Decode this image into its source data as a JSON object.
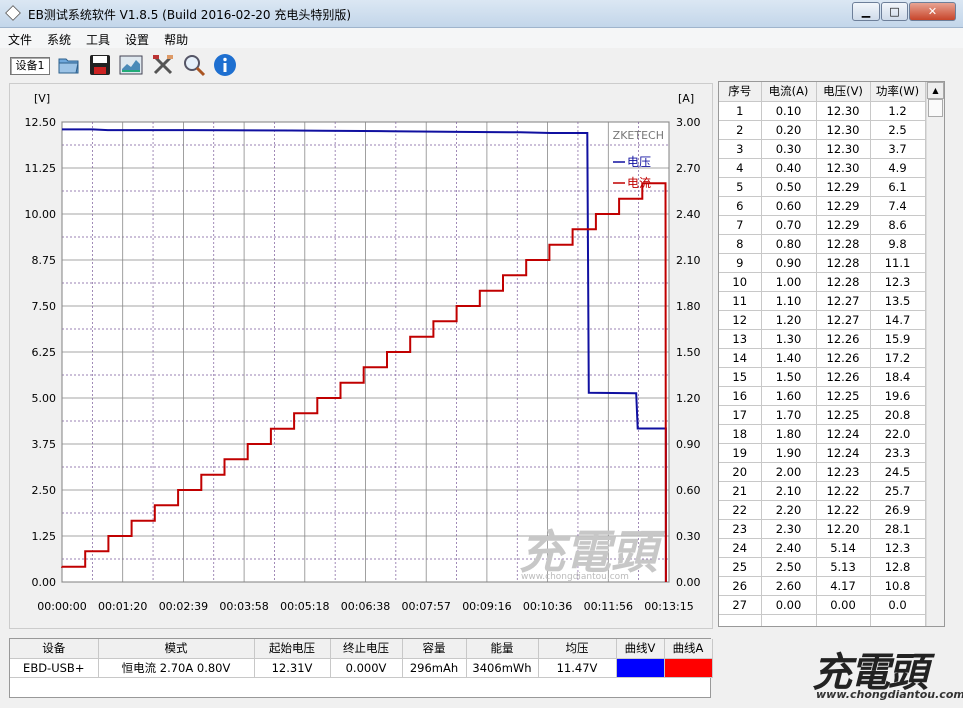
{
  "window": {
    "title": "EB测试系统软件 V1.8.5 (Build 2016-02-20 充电头特别版)",
    "min_label": "▁",
    "max_label": "□",
    "close_label": "✕"
  },
  "menu": {
    "items": [
      "文件",
      "系统",
      "工具",
      "设置",
      "帮助"
    ]
  },
  "toolbar": {
    "device_label": "设备1",
    "icons": [
      "folder-icon",
      "save-icon",
      "chart-icon",
      "tools-icon",
      "magnify-icon",
      "info-icon"
    ]
  },
  "chart_data": {
    "type": "line",
    "left_unit": "[V]",
    "right_unit": "[A]",
    "left_ticks": [
      "12.50",
      "11.25",
      "10.00",
      "8.75",
      "7.50",
      "6.25",
      "5.00",
      "3.75",
      "2.50",
      "1.25",
      "0.00"
    ],
    "right_ticks": [
      "3.00",
      "2.70",
      "2.40",
      "2.10",
      "1.80",
      "1.50",
      "1.20",
      "0.90",
      "0.60",
      "0.30",
      "0.00"
    ],
    "x_ticks": [
      "00:00:00",
      "00:01:20",
      "00:02:39",
      "00:03:58",
      "00:05:18",
      "00:06:38",
      "00:07:57",
      "00:09:16",
      "00:10:36",
      "00:11:56",
      "00:13:15"
    ],
    "x_range_seconds": [
      0,
      795
    ],
    "ylim_left": [
      0,
      12.5
    ],
    "ylim_right": [
      0,
      3.0
    ],
    "brand": "ZKETECH",
    "legend_placement": "top-right",
    "grid": true,
    "series": [
      {
        "name": "电压",
        "axis": "left",
        "color": "#1010a0",
        "points": [
          [
            0,
            12.3
          ],
          [
            40,
            12.3
          ],
          [
            60,
            12.28
          ],
          [
            170,
            12.28
          ],
          [
            300,
            12.27
          ],
          [
            340,
            12.26
          ],
          [
            430,
            12.25
          ],
          [
            520,
            12.23
          ],
          [
            600,
            12.22
          ],
          [
            640,
            12.2
          ],
          [
            688,
            12.2
          ],
          [
            690,
            5.14
          ],
          [
            752,
            5.13
          ],
          [
            754,
            4.17
          ],
          [
            791,
            4.17
          ],
          [
            791,
            0.0
          ]
        ]
      },
      {
        "name": "电流",
        "axis": "right",
        "color": "#c00000",
        "current_step_values": [
          0.1,
          0.2,
          0.3,
          0.4,
          0.5,
          0.6,
          0.7,
          0.8,
          0.9,
          1.0,
          1.1,
          1.2,
          1.3,
          1.4,
          1.5,
          1.6,
          1.7,
          1.8,
          1.9,
          2.0,
          2.1,
          2.2,
          2.3,
          2.4,
          2.5,
          2.6
        ],
        "step_seconds": 30.4,
        "end_seconds": 791
      }
    ]
  },
  "data_table": {
    "headers": [
      "序号",
      "电流(A)",
      "电压(V)",
      "功率(W)"
    ],
    "rows": [
      [
        "1",
        "0.10",
        "12.30",
        "1.2"
      ],
      [
        "2",
        "0.20",
        "12.30",
        "2.5"
      ],
      [
        "3",
        "0.30",
        "12.30",
        "3.7"
      ],
      [
        "4",
        "0.40",
        "12.30",
        "4.9"
      ],
      [
        "5",
        "0.50",
        "12.29",
        "6.1"
      ],
      [
        "6",
        "0.60",
        "12.29",
        "7.4"
      ],
      [
        "7",
        "0.70",
        "12.29",
        "8.6"
      ],
      [
        "8",
        "0.80",
        "12.28",
        "9.8"
      ],
      [
        "9",
        "0.90",
        "12.28",
        "11.1"
      ],
      [
        "10",
        "1.00",
        "12.28",
        "12.3"
      ],
      [
        "11",
        "1.10",
        "12.27",
        "13.5"
      ],
      [
        "12",
        "1.20",
        "12.27",
        "14.7"
      ],
      [
        "13",
        "1.30",
        "12.26",
        "15.9"
      ],
      [
        "14",
        "1.40",
        "12.26",
        "17.2"
      ],
      [
        "15",
        "1.50",
        "12.26",
        "18.4"
      ],
      [
        "16",
        "1.60",
        "12.25",
        "19.6"
      ],
      [
        "17",
        "1.70",
        "12.25",
        "20.8"
      ],
      [
        "18",
        "1.80",
        "12.24",
        "22.0"
      ],
      [
        "19",
        "1.90",
        "12.24",
        "23.3"
      ],
      [
        "20",
        "2.00",
        "12.23",
        "24.5"
      ],
      [
        "21",
        "2.10",
        "12.22",
        "25.7"
      ],
      [
        "22",
        "2.20",
        "12.22",
        "26.9"
      ],
      [
        "23",
        "2.30",
        "12.20",
        "28.1"
      ],
      [
        "24",
        "2.40",
        "5.14",
        "12.3"
      ],
      [
        "25",
        "2.50",
        "5.13",
        "12.8"
      ],
      [
        "26",
        "2.60",
        "4.17",
        "10.8"
      ],
      [
        "27",
        "0.00",
        "0.00",
        "0.0"
      ]
    ]
  },
  "summary": {
    "headers": [
      "设备",
      "模式",
      "起始电压",
      "终止电压",
      "容量",
      "能量",
      "均压",
      "曲线V",
      "曲线A"
    ],
    "values": [
      "EBD-USB+",
      "恒电流  2.70A  0.80V",
      "12.31V",
      "0.000V",
      "296mAh",
      "3406mWh",
      "11.47V",
      "",
      ""
    ],
    "curve_v_color": "#0000ff",
    "curve_a_color": "#ff0000"
  },
  "watermark": {
    "logo_text": "充電頭",
    "url": "www.chongdiantou.com"
  }
}
